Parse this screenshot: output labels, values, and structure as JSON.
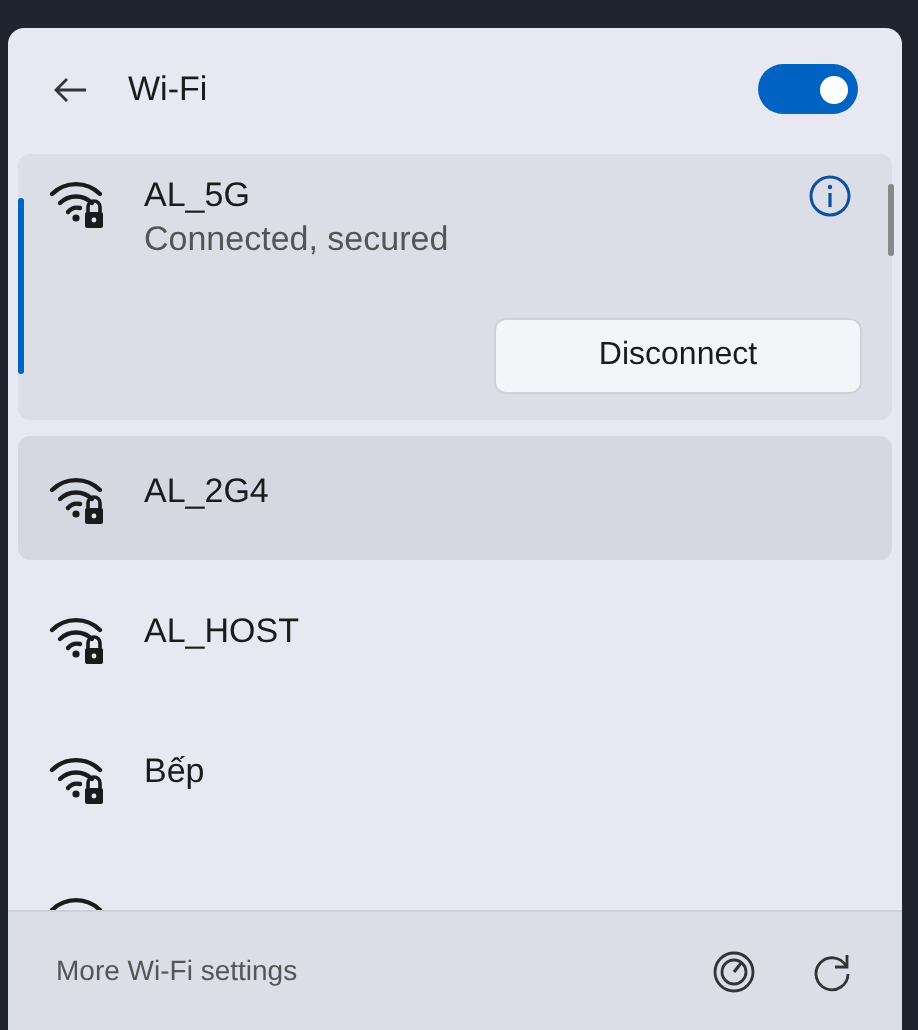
{
  "header": {
    "title": "Wi-Fi",
    "wifi_on": true
  },
  "networks": [
    {
      "name": "AL_5G",
      "status": "Connected, secured",
      "secured": true,
      "selected": true,
      "highlighted": false,
      "action": "Disconnect"
    },
    {
      "name": "AL_2G4",
      "secured": true,
      "selected": false,
      "highlighted": true
    },
    {
      "name": "AL_HOST",
      "secured": true,
      "selected": false,
      "highlighted": false
    },
    {
      "name": "Bếp",
      "secured": true,
      "selected": false,
      "highlighted": false
    },
    {
      "selected": false,
      "highlighted": false
    }
  ],
  "footer": {
    "link": "More Wi-Fi settings"
  }
}
